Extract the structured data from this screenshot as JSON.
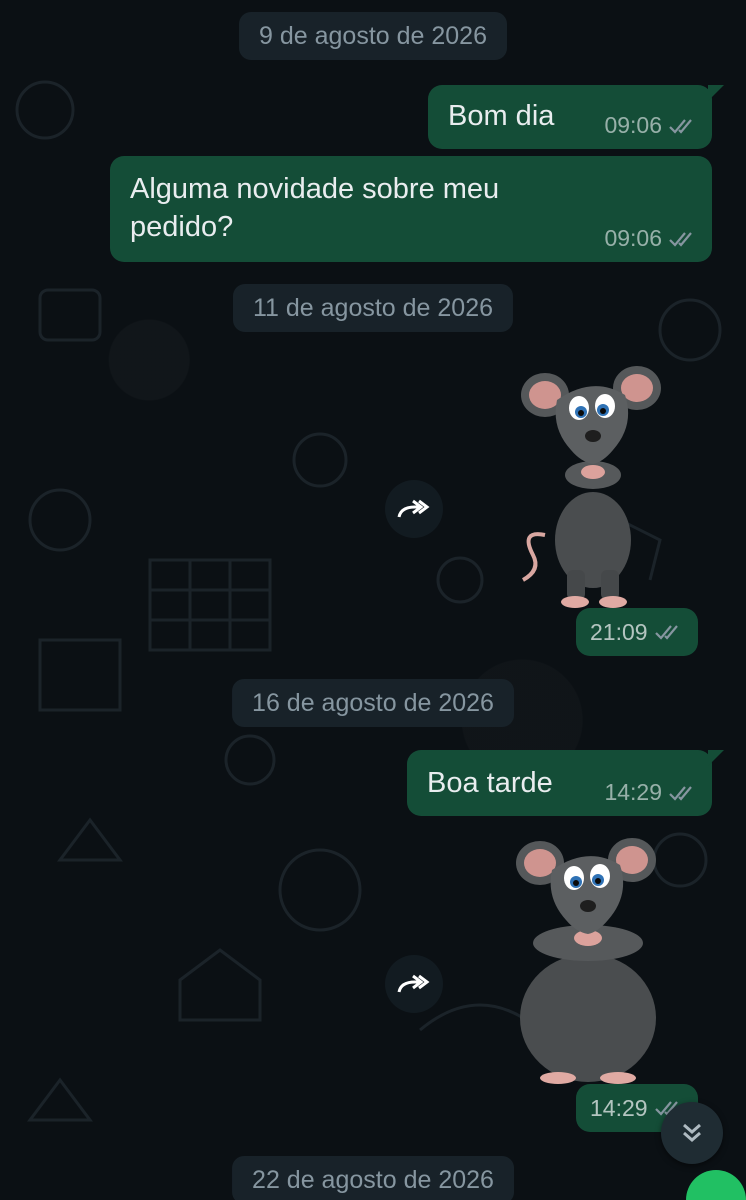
{
  "dates": [
    "9 de agosto de 2026",
    "11 de agosto de 2026",
    "16 de agosto de 2026",
    "22 de agosto de 2026"
  ],
  "messages": [
    {
      "text": "Bom dia",
      "time": "09:06"
    },
    {
      "text": "Alguma novidade sobre meu pedido?",
      "time": "09:06"
    },
    {
      "text": "",
      "time": "21:09"
    },
    {
      "text": "Boa tarde",
      "time": "14:29"
    },
    {
      "text": "",
      "time": "14:29"
    }
  ],
  "icons": {
    "read_receipt": "double-check-icon",
    "forward": "forward-icon",
    "scroll_down": "double-chevron-down-icon",
    "stickers": "mouse-sticker"
  },
  "colors": {
    "background": "#0b1014",
    "outgoing_bubble": "#144d37",
    "date_chip": "#182229",
    "text": "#e9edef",
    "meta": "#8696a0",
    "accent": "#21c063"
  }
}
